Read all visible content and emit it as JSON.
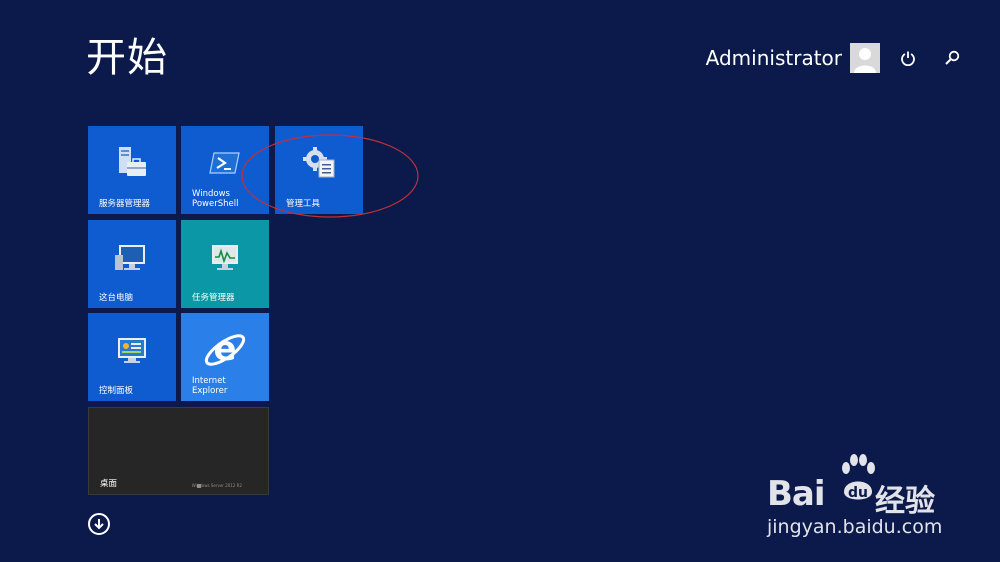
{
  "start": {
    "title": "开始"
  },
  "user": {
    "name": "Administrator"
  },
  "icons": {
    "power": "power-icon",
    "search": "search-icon",
    "avatar": "user-avatar-icon",
    "down": "arrow-down-circle-icon"
  },
  "tiles": [
    {
      "label": "服务器管理器",
      "icon": "server-manager-icon",
      "color": "#0f5bd0"
    },
    {
      "label": "Windows\nPowerShell",
      "icon": "powershell-icon",
      "color": "#0f5bd0"
    },
    {
      "label": "管理工具",
      "icon": "admin-tools-icon",
      "color": "#0f5bd0"
    },
    {
      "label": "这台电脑",
      "icon": "this-pc-icon",
      "color": "#0f5bd0"
    },
    {
      "label": "任务管理器",
      "icon": "task-manager-icon",
      "color": "#0b97a6"
    },
    {
      "label": "控制面板",
      "icon": "control-panel-icon",
      "color": "#0f5bd0"
    },
    {
      "label": "Internet\nExplorer",
      "icon": "ie-icon",
      "color": "#2b7fe8"
    },
    {
      "label": "桌面",
      "icon": "desktop-icon",
      "color": "#262626",
      "sublabel": "Windows Server 2012 R2"
    }
  ],
  "watermark": {
    "brand": "Bai",
    "brand_suffix": "经验",
    "paw_text": "du",
    "url": "jingyan.baidu.com"
  },
  "annotation": {
    "color": "#c0303a"
  }
}
